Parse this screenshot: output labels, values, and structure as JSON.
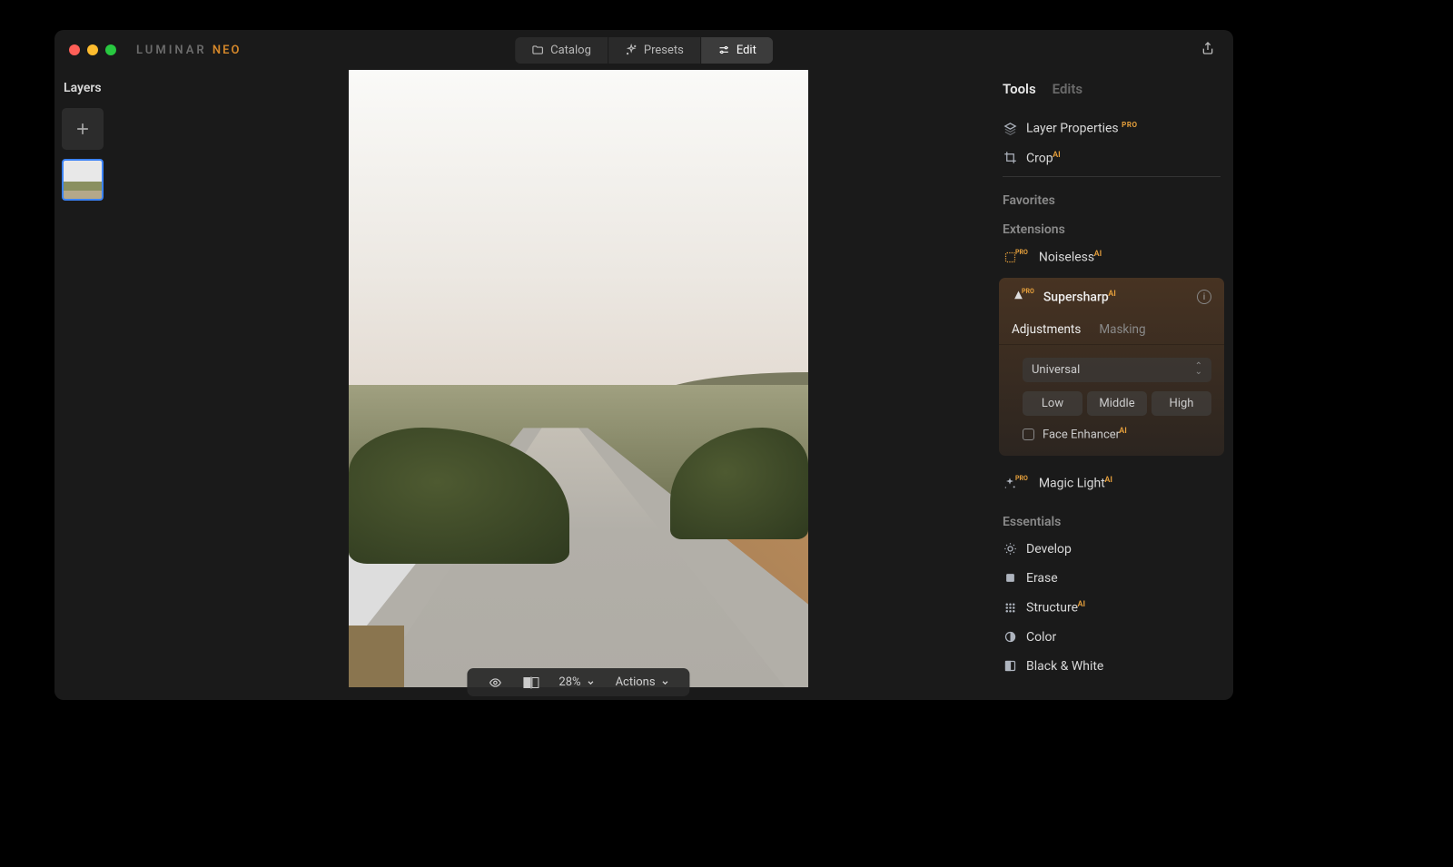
{
  "app": {
    "name": "LUMINAR",
    "suffix": "NEO"
  },
  "topTabs": {
    "catalog": "Catalog",
    "presets": "Presets",
    "edit": "Edit"
  },
  "layers": {
    "title": "Layers"
  },
  "bottomBar": {
    "zoom": "28%",
    "actions": "Actions"
  },
  "rightTabs": {
    "tools": "Tools",
    "edits": "Edits"
  },
  "tools": {
    "layerProperties": "Layer Properties",
    "crop": "Crop"
  },
  "sections": {
    "favorites": "Favorites",
    "extensions": "Extensions",
    "essentials": "Essentials"
  },
  "extensions": {
    "noiseless": "Noiseless",
    "supersharp": "Supersharp",
    "magicLight": "Magic Light"
  },
  "supersharp": {
    "tabs": {
      "adjustments": "Adjustments",
      "masking": "Masking"
    },
    "preset": "Universal",
    "levels": {
      "low": "Low",
      "middle": "Middle",
      "high": "High"
    },
    "faceEnhancer": "Face Enhancer"
  },
  "essentials": {
    "develop": "Develop",
    "erase": "Erase",
    "structure": "Structure",
    "color": "Color",
    "bw": "Black & White"
  },
  "badges": {
    "ai": "AI",
    "pro": "PRO"
  }
}
